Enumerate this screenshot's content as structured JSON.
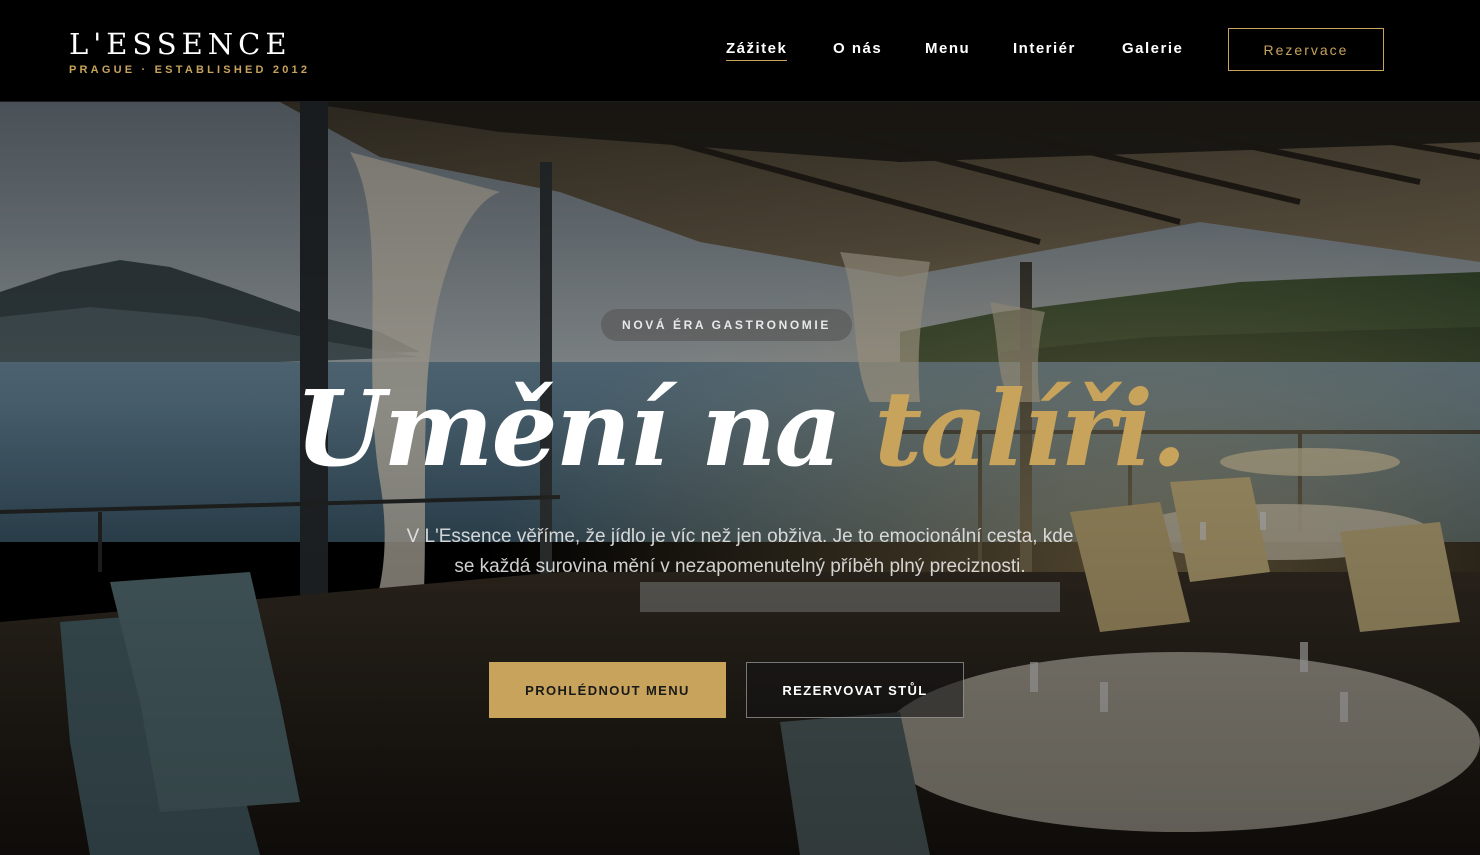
{
  "brand": {
    "name": "L'ESSENCE",
    "tagline": "PRAGUE · ESTABLISHED 2012",
    "accent_color": "#c7a35b"
  },
  "nav": {
    "items": [
      {
        "label": "Zážitek",
        "active": true
      },
      {
        "label": "O nás",
        "active": false
      },
      {
        "label": "Menu",
        "active": false
      },
      {
        "label": "Interiér",
        "active": false
      },
      {
        "label": "Galerie",
        "active": false
      }
    ],
    "reserve_label": "Rezervace"
  },
  "hero": {
    "badge": "NOVÁ ÉRA GASTRONOMIE",
    "headline_main": "Umění na ",
    "headline_accent": "talíři.",
    "lead": "V L'Essence věříme, že jídlo je víc než jen obživa. Je to emocionální cesta, kde se každá surovina mění v nezapomenutelný příběh plný preciznosti.",
    "primary_button": "PROHLÉDNOUT MENU",
    "secondary_button": "REZERVOVAT STŮL",
    "background_image": "lakeside-terrace-restaurant"
  }
}
